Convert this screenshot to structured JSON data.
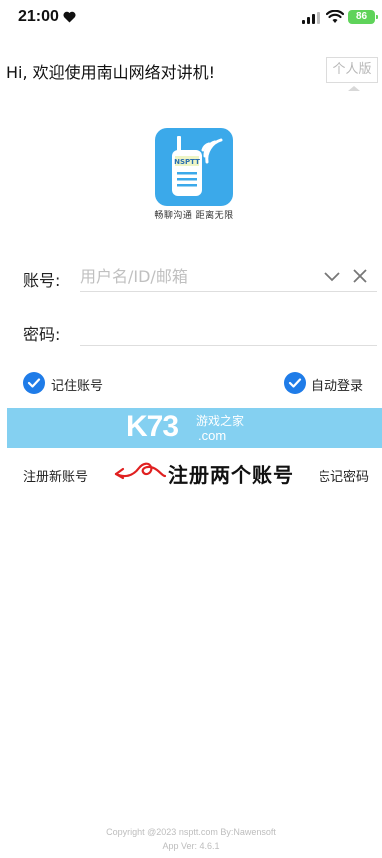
{
  "status_bar": {
    "time": "21:00",
    "battery": "86"
  },
  "header": {
    "welcome": "Hi, 欢迎使用南山网络对讲机!",
    "edition_label": "个人版"
  },
  "logo": {
    "badge_text": "NSPTT",
    "slogan": "畅聊沟通 距离无限"
  },
  "form": {
    "account_label": "账号:",
    "account_placeholder": "用户名/ID/邮箱",
    "password_label": "密码:",
    "remember_label": "记住账号",
    "autologin_label": "自动登录",
    "remember_checked": true,
    "autologin_checked": true
  },
  "watermark": {
    "brand": "K73",
    "site_cn": "游戏之家",
    "site_com": ".com"
  },
  "links": {
    "register": "注册新账号",
    "forgot_partial": "忘记密码"
  },
  "annotation": {
    "text": "注册两个账号"
  },
  "footer": {
    "copyright": "Copyright @2023 nsptt.com By:Nawensoft",
    "version": "App Ver: 4.6.1"
  },
  "colors": {
    "accent": "#1f7ce8",
    "login_button": "#84d0f1",
    "logo_bg": "#3ba9ea",
    "battery": "#5fd35a"
  },
  "icons": {
    "heart": "heart-icon",
    "signal": "signal-icon",
    "wifi": "wifi-icon",
    "dropdown": "chevron-down-icon",
    "clear": "close-icon",
    "check": "check-icon",
    "arrow": "arrow-icon"
  }
}
